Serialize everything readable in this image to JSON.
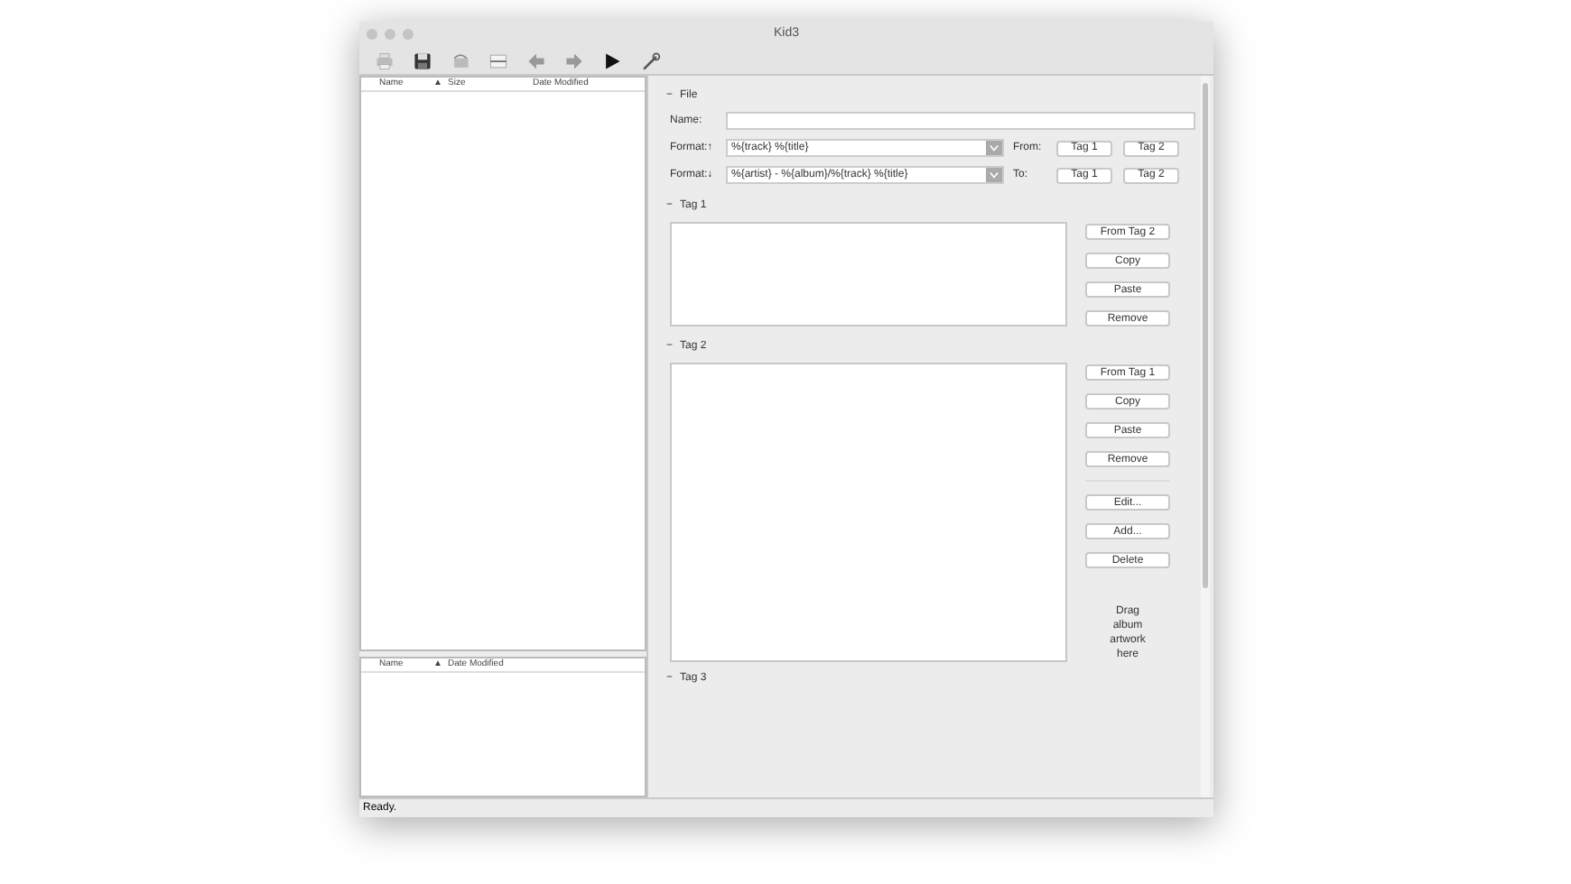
{
  "window": {
    "title": "Kid3"
  },
  "file_list": {
    "columns": [
      "Name",
      "▲",
      "Size",
      "Date Modified"
    ]
  },
  "dir_list": {
    "columns": [
      "Name",
      "▲",
      "Date Modified"
    ]
  },
  "file_section": {
    "heading": "File",
    "toggle": "−",
    "name_label": "Name:",
    "format_rows": [
      {
        "label": "Format:↑",
        "value": "%{track} %{title}",
        "direction": "From:",
        "buttons": [
          "Tag 1",
          "Tag 2"
        ]
      },
      {
        "label": "Format:↓",
        "value": "%{artist} - %{album}/%{track} %{title}",
        "direction": "To:",
        "buttons": [
          "Tag 1",
          "Tag 2"
        ]
      }
    ]
  },
  "tag1": {
    "heading": "Tag 1",
    "toggle": "−",
    "buttons": [
      "From Tag 2",
      "Copy",
      "Paste",
      "Remove"
    ]
  },
  "tag2": {
    "heading": "Tag 2",
    "toggle": "−",
    "buttons": [
      "From Tag 1",
      "Copy",
      "Paste",
      "Remove"
    ],
    "picture_buttons": [
      "Edit...",
      "Add...",
      "Delete"
    ],
    "drop_hint": "Drag album artwork here"
  },
  "tag3": {
    "heading": "Tag 3",
    "toggle": "−"
  },
  "status_bar": "Ready."
}
